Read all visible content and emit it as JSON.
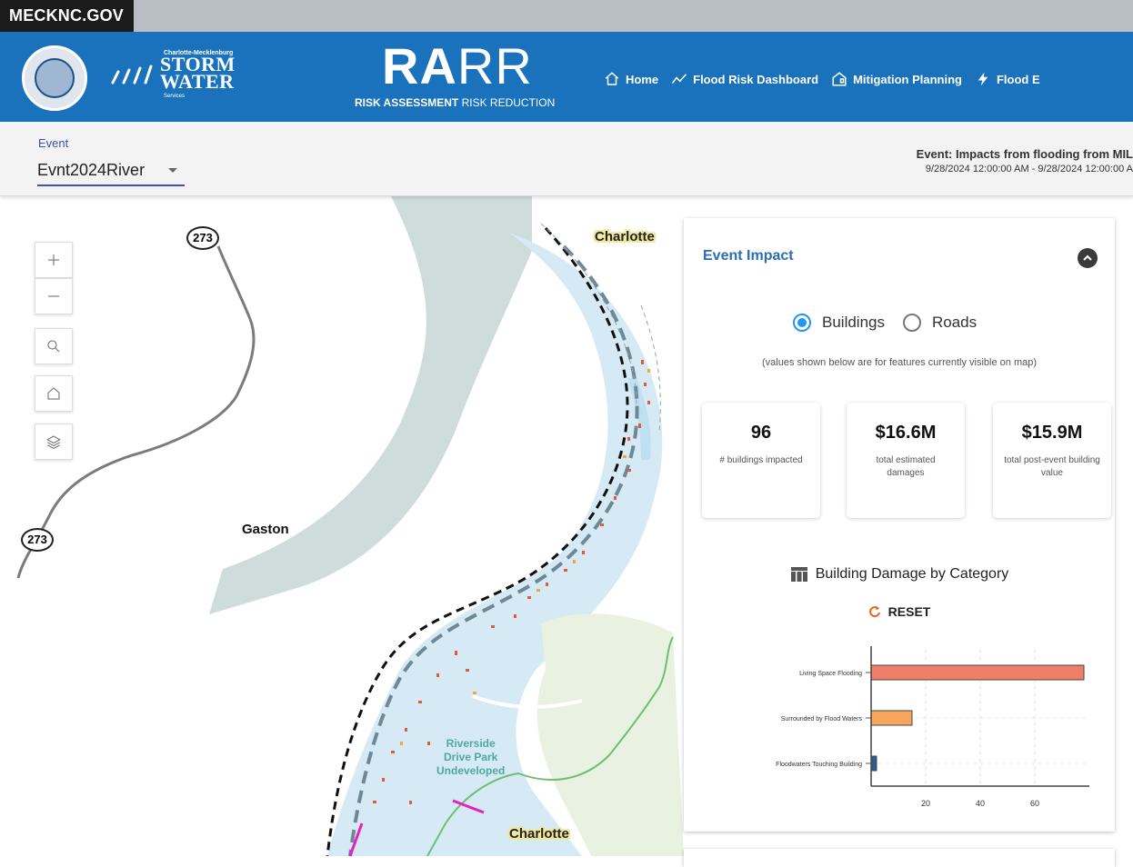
{
  "gov": {
    "label": "MECKNC.GOV"
  },
  "header": {
    "storm_small": "Charlotte-Mecklenburg",
    "storm_line1": "STORM",
    "storm_line2": "WATER",
    "storm_sub": "Services",
    "rarr_bold": "RA",
    "rarr_light": "RR",
    "rarr_sub_bold": "RISK ASSESSMENT",
    "rarr_sub_light": " RISK REDUCTION",
    "nav": [
      {
        "label": "Home",
        "icon": "home-icon"
      },
      {
        "label": "Flood Risk Dashboard",
        "icon": "chart-line-icon"
      },
      {
        "label": "Mitigation Planning",
        "icon": "building-icon"
      },
      {
        "label": "Flood E",
        "icon": "lightning-icon"
      }
    ]
  },
  "event": {
    "label": "Event",
    "selected": "Evnt2024River",
    "info_title": "Event: Impacts from flooding from MIL",
    "info_dates": "9/28/2024 12:00:00 AM - 9/28/2024 12:00:00 A"
  },
  "map": {
    "labels": {
      "gaston": "Gaston",
      "charlotte_top": "Charlotte",
      "charlotte_bottom": "Charlotte"
    },
    "shields": {
      "top": "273",
      "left": "273"
    },
    "park": {
      "line1": "Riverside",
      "line2": "Drive Park",
      "line3": "Undeveloped"
    }
  },
  "panel": {
    "title": "Event Impact",
    "radio_buildings": "Buildings",
    "radio_roads": "Roads",
    "selected_radio": "Buildings",
    "note": "(values shown below are for features currently visible on map)",
    "stats": [
      {
        "value": "96",
        "label": "# buildings impacted"
      },
      {
        "value": "$16.6M",
        "label": "total estimated damages"
      },
      {
        "value": "$15.9M",
        "label": "total post-event building value"
      }
    ],
    "chart_title": "Building Damage by Category",
    "reset_label": "RESET"
  },
  "colors": {
    "header_blue": "#1a72bd",
    "accent": "#2196f3",
    "bar_living": "#f07f6a",
    "bar_surrounded": "#f8a65c",
    "bar_touching": "#2c5f8f"
  },
  "chart_data": {
    "type": "bar",
    "orientation": "horizontal",
    "categories": [
      "Living Space Flooding",
      "Surrounded by Flood Waters",
      "Floodwaters Touching Building"
    ],
    "values": [
      78,
      15,
      2
    ],
    "xticks": [
      20,
      40,
      60
    ],
    "xlim": [
      0,
      80
    ],
    "grid": true
  }
}
